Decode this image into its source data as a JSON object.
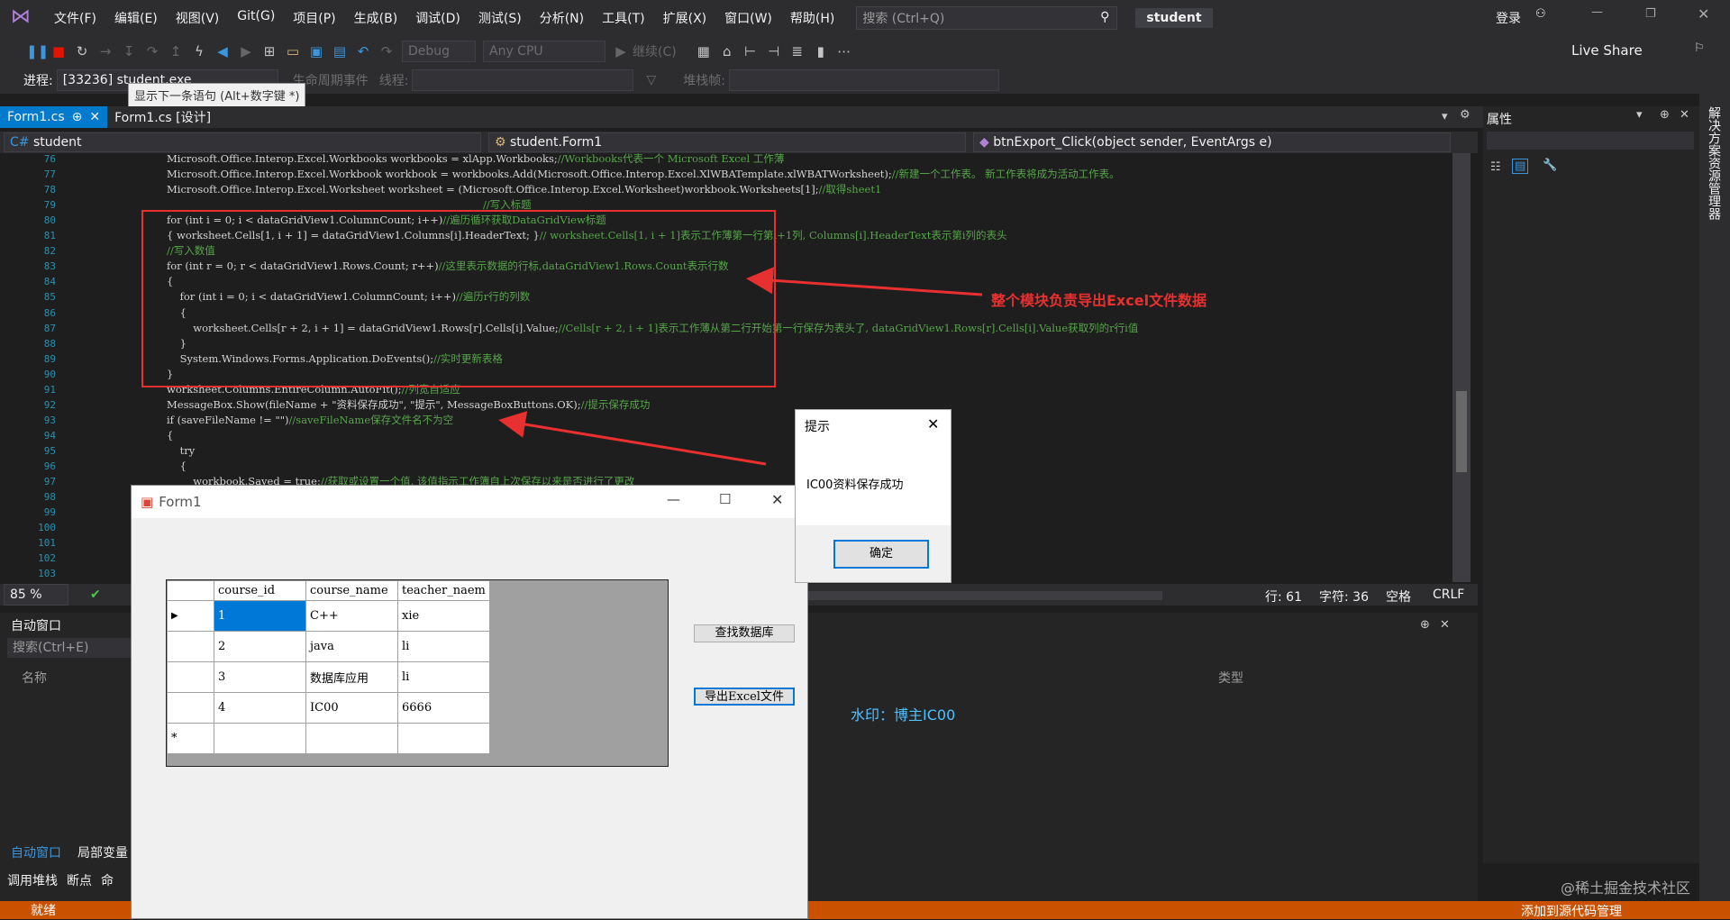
{
  "titlebar": {
    "menus": [
      "文件(F)",
      "编辑(E)",
      "视图(V)",
      "Git(G)",
      "项目(P)",
      "生成(B)",
      "调试(D)",
      "测试(S)",
      "分析(N)",
      "工具(T)",
      "扩展(X)",
      "窗口(W)",
      "帮助(H)"
    ],
    "search_placeholder": "搜索 (Ctrl+Q)",
    "project": "student",
    "login": "登录"
  },
  "toolbar": {
    "config": "Debug",
    "platform": "Any CPU",
    "continue": "继续(C)",
    "live_share": "Live Share",
    "process_label": "进程:",
    "process_value": "[33236] student.exe",
    "lifecycle": "生命周期事件",
    "thread_label": "线程:",
    "stack_label": "堆栈帧:"
  },
  "tooltip": "显示下一条语句 (Alt+数字键 *)",
  "tabs": {
    "tab1": "Form1.cs",
    "tab2": "Form1.cs [设计]"
  },
  "nav": {
    "project": "student",
    "class": "student.Form1",
    "method": "btnExport_Click(object sender, EventArgs e)"
  },
  "code": {
    "lines": [
      {
        "n": "76",
        "t": "Microsoft.Office.Interop.Excel.Workbooks workbooks = xlApp.Workbooks;//Workbooks代表一个 Microsoft Excel 工作薄"
      },
      {
        "n": "77",
        "t": "Microsoft.Office.Interop.Excel.Workbook workbook = workbooks.Add(Microsoft.Office.Interop.Excel.XlWBATemplate.xlWBATWorksheet);//新建一个工作表。 新工作表将成为活动工作表。"
      },
      {
        "n": "78",
        "t": "Microsoft.Office.Interop.Excel.Worksheet worksheet = (Microsoft.Office.Interop.Excel.Worksheet)workbook.Worksheets[1];//取得sheet1"
      },
      {
        "n": "79",
        "t": "                                                                                                //写入标题"
      },
      {
        "n": "80",
        "t": "for (int i = 0; i < dataGridView1.ColumnCount; i++)//遍历循环获取DataGridView标题"
      },
      {
        "n": "81",
        "t": "{ worksheet.Cells[1, i + 1] = dataGridView1.Columns[i].HeaderText; }// worksheet.Cells[1, i + 1]表示工作薄第一行第i+1列, Columns[i].HeaderText表示第i列的表头"
      },
      {
        "n": "82",
        "t": "//写入数值"
      },
      {
        "n": "83",
        "t": "for (int r = 0; r < dataGridView1.Rows.Count; r++)//这里表示数据的行标,dataGridView1.Rows.Count表示行数"
      },
      {
        "n": "84",
        "t": "{"
      },
      {
        "n": "85",
        "t": "    for (int i = 0; i < dataGridView1.ColumnCount; i++)//遍历r行的列数"
      },
      {
        "n": "86",
        "t": "    {"
      },
      {
        "n": "87",
        "t": "        worksheet.Cells[r + 2, i + 1] = dataGridView1.Rows[r].Cells[i].Value;//Cells[r + 2, i + 1]表示工作薄从第二行开始第一行保存为表头了, dataGridView1.Rows[r].Cells[i].Value获取列的r行i值"
      },
      {
        "n": "88",
        "t": "    }"
      },
      {
        "n": "89",
        "t": "    System.Windows.Forms.Application.DoEvents();//实时更新表格"
      },
      {
        "n": "90",
        "t": "}"
      },
      {
        "n": "91",
        "t": "worksheet.Columns.EntireColumn.AutoFit();//列宽自适应"
      },
      {
        "n": "92",
        "t": "MessageBox.Show(fileName + \"资料保存成功\", \"提示\", MessageBoxButtons.OK);//提示保存成功"
      },
      {
        "n": "93",
        "t": "if (saveFileName != \"\")//saveFileName保存文件名不为空"
      },
      {
        "n": "94",
        "t": "{"
      },
      {
        "n": "95",
        "t": "    try"
      },
      {
        "n": "96",
        "t": "    {"
      },
      {
        "n": "97",
        "t": "        workbook.Saved = true;//获取或设置一个值, 该值指示工作簿自上次保存以来是否进行了更改"
      },
      {
        "n": "98",
        "t": ""
      },
      {
        "n": "99",
        "t": ""
      },
      {
        "n": "100",
        "t": ""
      },
      {
        "n": "101",
        "t": ""
      },
      {
        "n": "102",
        "t": ""
      },
      {
        "n": "103",
        "t": ""
      }
    ]
  },
  "annotation": "整个模块负责导出Excel文件数据",
  "statusline": {
    "zoom": "85 %",
    "row": "行: 61",
    "col": "字符: 36",
    "space": "空格",
    "eol": "CRLF"
  },
  "autowin": {
    "title": "自动窗口",
    "search": "搜索(Ctrl+E)",
    "col_name": "名称",
    "col_type": "类型",
    "tab_auto": "自动窗口",
    "tab_local": "局部变量"
  },
  "bottom_tabs": [
    "调用堆栈",
    "断点",
    "命"
  ],
  "properties": {
    "title": "属性"
  },
  "right_strip": "解决方案资源管理器",
  "statusbar": {
    "ready": "就绪",
    "source": "添加到源代码管理"
  },
  "form1": {
    "title": "Form1",
    "columns": [
      "course_id",
      "course_name",
      "teacher_naem"
    ],
    "rows": [
      [
        "1",
        "C++",
        "xie"
      ],
      [
        "2",
        "java",
        "li"
      ],
      [
        "3",
        "数据库应用",
        "li"
      ],
      [
        "4",
        "IC00",
        "6666"
      ]
    ],
    "btn_query": "查找数据库",
    "btn_export": "导出Excel文件"
  },
  "msgbox": {
    "title": "提示",
    "message": "IC00资料保存成功",
    "ok": "确定"
  },
  "watermark": "水印：博主IC00",
  "credit": "@稀土掘金技术社区"
}
